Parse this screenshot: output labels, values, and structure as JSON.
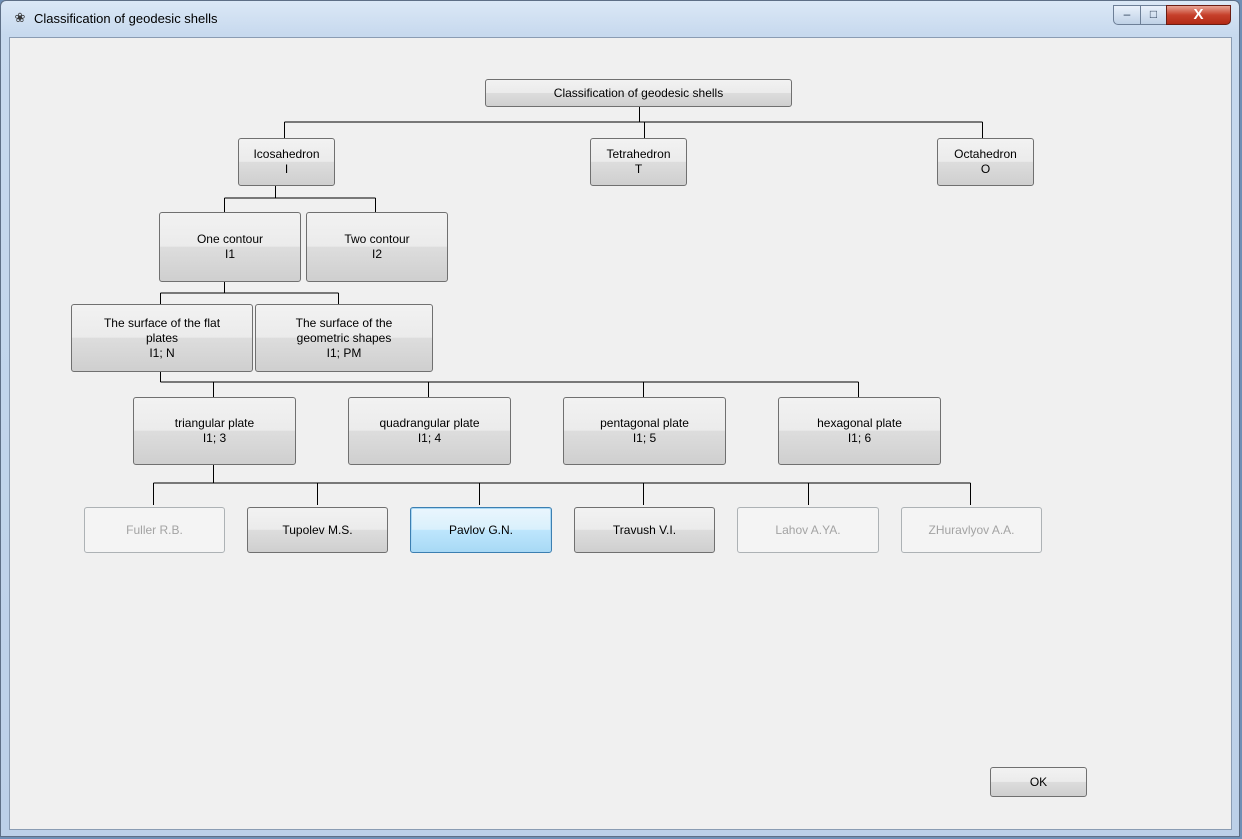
{
  "window": {
    "title": "Classification of geodesic shells",
    "controls": {
      "minimize": "–",
      "maximize": "□",
      "close": "X"
    }
  },
  "tree": {
    "root": "Classification of geodesic shells",
    "level1": [
      {
        "name": "Icosahedron",
        "code": "I"
      },
      {
        "name": "Tetrahedron",
        "code": "T"
      },
      {
        "name": "Octahedron",
        "code": "O"
      }
    ],
    "contours": [
      {
        "name": "One  contour",
        "code": "I1"
      },
      {
        "name": "Two  contour",
        "code": "I2"
      }
    ],
    "surfaces": [
      {
        "line1": "The surface of the flat",
        "line2": "plates",
        "code": "I1; N"
      },
      {
        "line1": "The surface of the",
        "line2": "geometric shapes",
        "code": "I1; PM"
      }
    ],
    "plates": [
      {
        "name": "triangular plate",
        "code": "I1; 3"
      },
      {
        "name": "quadrangular plate",
        "code": "I1; 4"
      },
      {
        "name": "pentagonal plate",
        "code": "I1; 5"
      },
      {
        "name": "hexagonal plate",
        "code": "I1; 6"
      }
    ],
    "authors": [
      {
        "name": "Fuller R.B.",
        "state": "disabled"
      },
      {
        "name": "Tupolev M.S.",
        "state": "enabled"
      },
      {
        "name": "Pavlov G.N.",
        "state": "focused"
      },
      {
        "name": "Travush V.I.",
        "state": "enabled"
      },
      {
        "name": "Lahov A.YA.",
        "state": "disabled"
      },
      {
        "name": "ZHuravlyov A.A.",
        "state": "disabled"
      }
    ]
  },
  "ok_label": "OK"
}
